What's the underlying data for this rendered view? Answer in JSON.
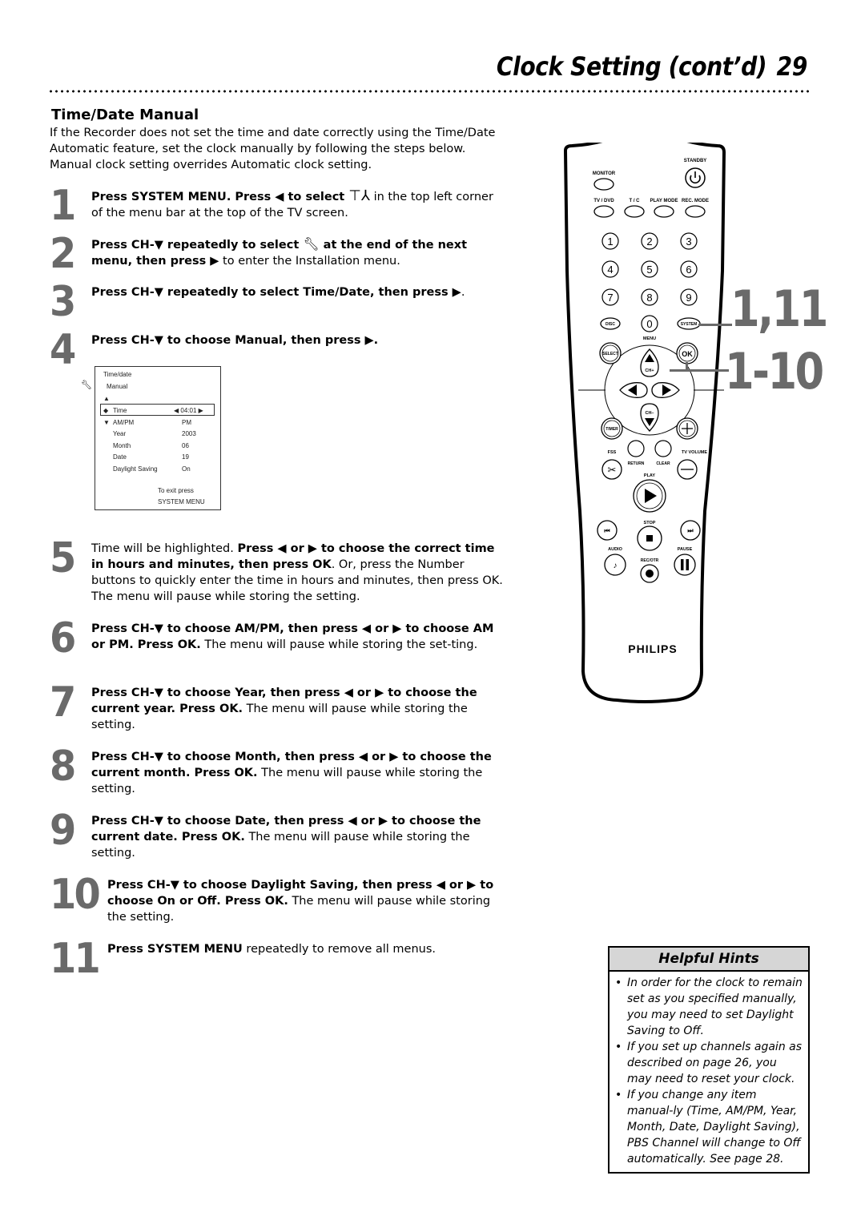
{
  "header": {
    "title": "Clock Setting (cont’d)",
    "page_number": "29"
  },
  "section": {
    "title": "Time/Date Manual",
    "intro": "If the Recorder does not set the time and date correctly using the Time/Date Automatic feature, set the clock manually by following the steps below. Manual clock setting overrides Automatic clock setting."
  },
  "steps": [
    {
      "num": "1",
      "bold": "Press SYSTEM MENU. Press ◀ to select ",
      "icon": "system-menu-icon",
      "rest": " in the top left corner of the menu bar at the top of the TV screen."
    },
    {
      "num": "2",
      "bold": "Press CH-▼ repeatedly to select ",
      "icon": "wrench-icon",
      "bold2": " at the end of the next menu, then press ▶",
      "rest": " to enter the Installation menu."
    },
    {
      "num": "3",
      "bold": "Press CH-▼ repeatedly to select Time/Date, then press ▶",
      "rest": "."
    },
    {
      "num": "4",
      "bold": "Press CH-▼ to choose Manual, then press ▶.",
      "rest": ""
    },
    {
      "num": "5",
      "pre": "Time will be highlighted. ",
      "bold": "Press ◀ or ▶ to choose the correct time in hours and minutes, then press OK",
      "rest": ". Or, press the Number buttons to quickly enter the time in hours and minutes, then press OK. The menu will pause while storing the setting."
    },
    {
      "num": "6",
      "bold": "Press CH-▼ to choose AM/PM, then press ◀ or ▶ to choose AM or PM. Press OK.",
      "rest": " The menu will pause while storing the set-ting."
    },
    {
      "num": "7",
      "bold": "Press CH-▼ to choose Year, then press ◀ or ▶ to choose the current year. Press OK.",
      "rest": " The menu will pause while storing the setting."
    },
    {
      "num": "8",
      "bold": "Press CH-▼ to choose Month, then press ◀ or ▶ to choose the current month. Press OK.",
      "rest": " The menu will pause while storing the setting."
    },
    {
      "num": "9",
      "bold": "Press CH-▼ to choose Date, then press ◀ or ▶ to choose the current date. Press OK.",
      "rest": " The menu will pause while storing the setting."
    },
    {
      "num": "10",
      "bold": "Press CH-▼ to choose Daylight Saving, then press ◀ or ▶ to choose On or Off. Press OK.",
      "rest": " The menu will pause while storing the setting."
    },
    {
      "num": "11",
      "bold": "Press SYSTEM MENU",
      "rest": " repeatedly to remove all menus."
    }
  ],
  "menu_screen": {
    "title": "Time/date",
    "subtitle": "Manual",
    "up_arrow": "▲",
    "rows": [
      {
        "marker": "◆",
        "label": "Time",
        "value": "◀ 04:01 ▶",
        "selected": true
      },
      {
        "marker": "▼",
        "label": "AM/PM",
        "value": "PM"
      },
      {
        "marker": "",
        "label": "Year",
        "value": "2003"
      },
      {
        "marker": "",
        "label": "Month",
        "value": "06"
      },
      {
        "marker": "",
        "label": "Date",
        "value": "19"
      },
      {
        "marker": "",
        "label": "Daylight Saving",
        "value": "On"
      }
    ],
    "exit_line1": "To exit press",
    "exit_line2": "SYSTEM MENU"
  },
  "remote": {
    "labels": {
      "standby": "STANDBY",
      "monitor": "MONITOR",
      "tv_dvd": "TV / DVD",
      "tc": "T / C",
      "play_mode": "PLAY MODE",
      "rec_mode": "REC. MODE",
      "disc": "DISC",
      "zero": "0",
      "system": "SYSTEM",
      "menu": "MENU",
      "select": "SELECT",
      "ok": "OK",
      "ch_plus": "CH+",
      "ch_minus": "CH–",
      "timer": "TIMER",
      "fss": "FSS",
      "return": "RETURN",
      "clear": "CLEAR",
      "tv_volume": "TV VOLUME",
      "play": "PLAY",
      "stop": "STOP",
      "audio": "AUDIO",
      "pause": "PAUSE",
      "rec_otr": "REC/OTR",
      "brand": "PHILIPS"
    },
    "digits": [
      "1",
      "2",
      "3",
      "4",
      "5",
      "6",
      "7",
      "8",
      "9"
    ],
    "callouts": [
      "1,11",
      "1-10"
    ]
  },
  "hints": {
    "title": "Helpful Hints",
    "items": [
      "In order for the clock to remain set as you specified manually, you may need to set Daylight Saving to Off.",
      "If you set up channels again as described on page 26, you may need to reset your clock.",
      "If you change any item manual-ly (Time, AM/PM, Year, Month, Date, Daylight Saving), PBS Channel will change to Off automatically. See page 28."
    ]
  }
}
